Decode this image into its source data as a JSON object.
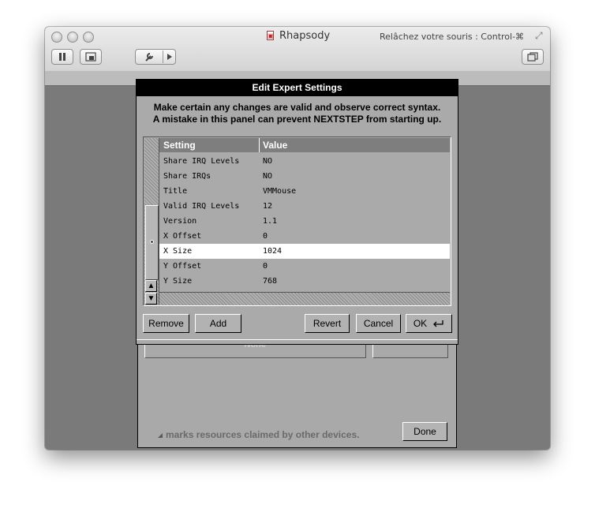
{
  "host_window": {
    "title": "Rhapsody",
    "capture_hint": "Relâchez votre souris : Control-⌘",
    "toolbar": {
      "pause_icon": "pause-icon",
      "snapshot_icon": "snapshot-icon",
      "settings_icon": "wrench-icon",
      "play_icon": "triangle-right-icon",
      "window_icon": "window-icon"
    }
  },
  "background_panel": {
    "field_text": "None",
    "footnote": "marks resources claimed by other devices.",
    "done_label": "Done"
  },
  "expert_panel": {
    "title": "Edit Expert Settings",
    "message_line1": "Make certain any changes are valid and observe correct syntax.",
    "message_line2": "A mistake in this panel can prevent NEXTSTEP from starting up.",
    "columns": {
      "setting": "Setting",
      "value": "Value"
    },
    "rows": [
      {
        "setting": "Share IRQ Levels",
        "value": "NO"
      },
      {
        "setting": "Share IRQs",
        "value": "NO"
      },
      {
        "setting": "Title",
        "value": "VMMouse"
      },
      {
        "setting": "Valid IRQ Levels",
        "value": "12"
      },
      {
        "setting": "Version",
        "value": "1.1"
      },
      {
        "setting": "X Offset",
        "value": "0"
      },
      {
        "setting": "X Size",
        "value": "1024",
        "selected": true
      },
      {
        "setting": "Y Offset",
        "value": "0"
      },
      {
        "setting": "Y Size",
        "value": "768"
      }
    ],
    "buttons": {
      "remove": "Remove",
      "add": "Add",
      "revert": "Revert",
      "cancel": "Cancel",
      "ok": "OK",
      "ok_icon": "return-key-icon"
    }
  }
}
